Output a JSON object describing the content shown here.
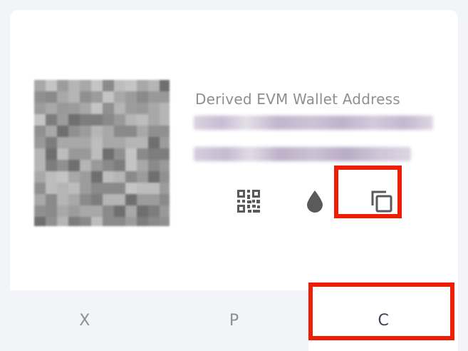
{
  "wallet": {
    "address_label": "Derived EVM Wallet Address"
  },
  "actions": [
    {
      "name": "qr-code",
      "icon": "qr-code-icon"
    },
    {
      "name": "faucet",
      "icon": "water-drop-icon"
    },
    {
      "name": "copy",
      "icon": "copy-icon"
    }
  ],
  "tabs": [
    {
      "label": "X",
      "active": false
    },
    {
      "label": "P",
      "active": false
    },
    {
      "label": "C",
      "active": true
    }
  ],
  "colors": {
    "highlight": "#f01d05",
    "active_tab_text": "#4a3a5c",
    "icon": "#5a5a5a"
  }
}
